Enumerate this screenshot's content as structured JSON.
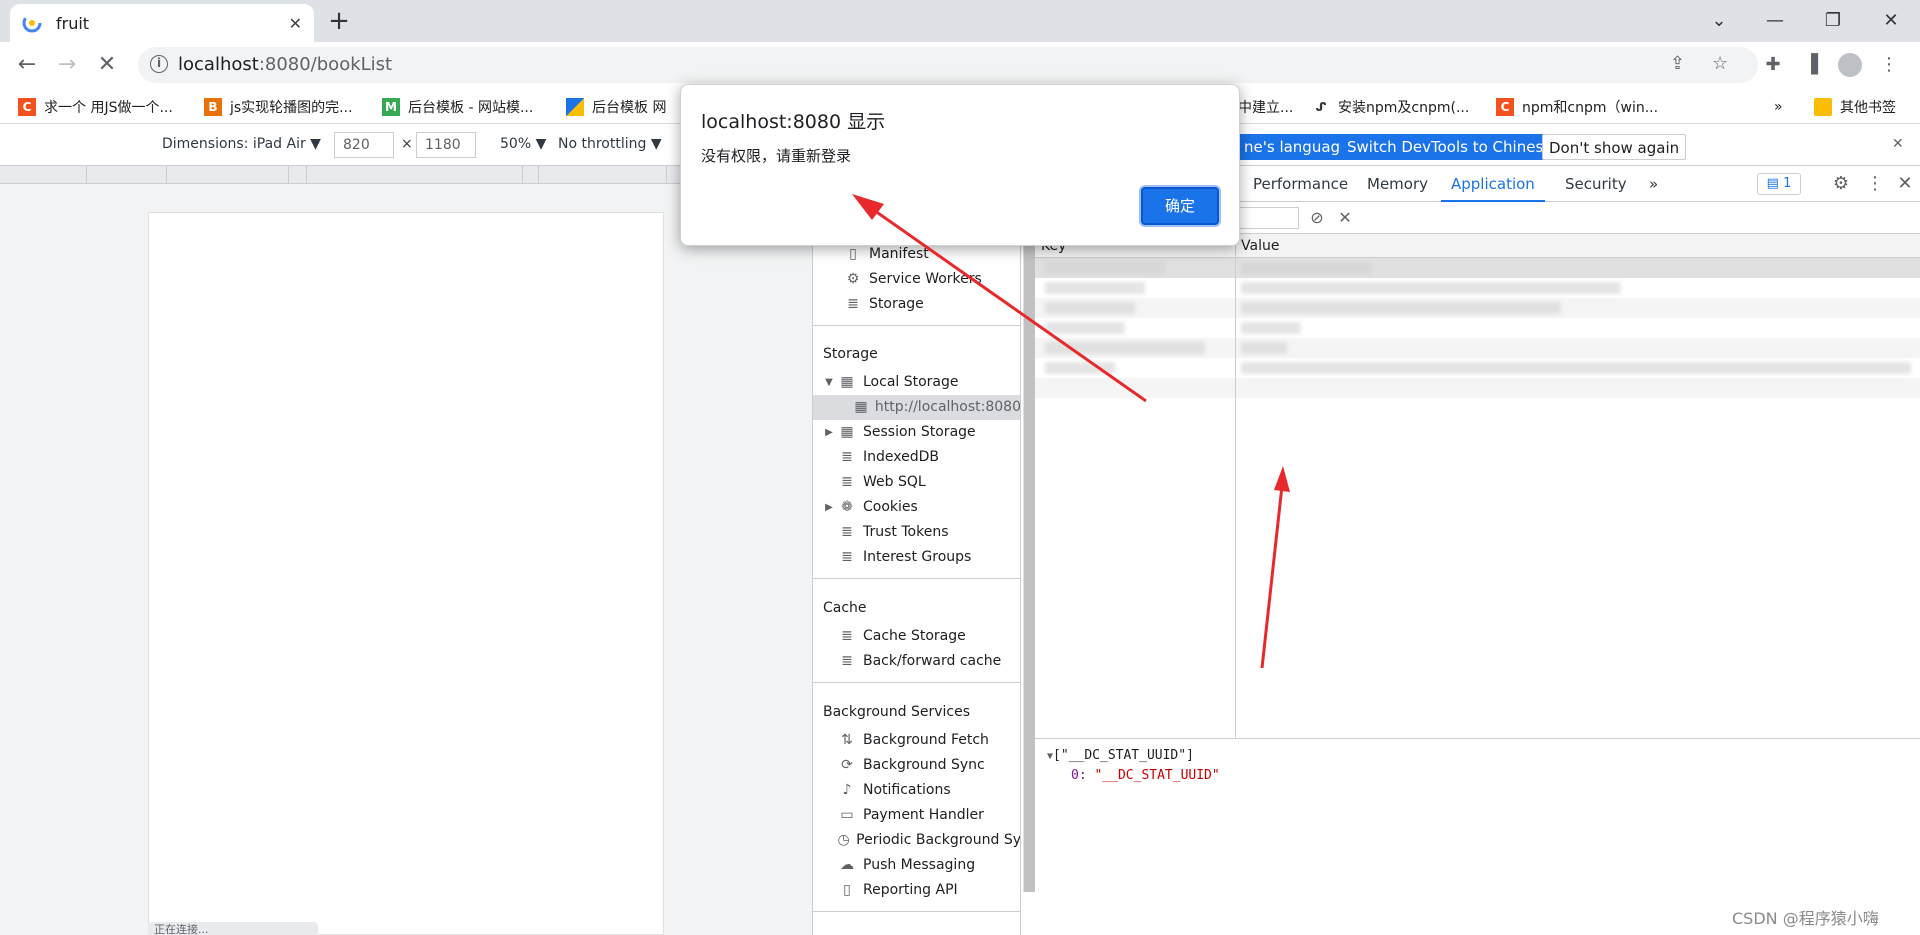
{
  "browser": {
    "tab_title": "fruit",
    "url_host": "localhost",
    "url_rest": ":8080/bookList"
  },
  "bookmarks": [
    {
      "label": "求一个 用JS做一个...",
      "icon": "C",
      "color": "#f4511e"
    },
    {
      "label": "js实现轮播图的完...",
      "icon": "B",
      "color": "#e8710a"
    },
    {
      "label": "后台模板 - 网站模...",
      "icon": "M",
      "color": "#34a853"
    },
    {
      "label": "后台模板 网",
      "icon": "",
      "color": "#1a73e8"
    },
    {
      "label": "中建立...",
      "icon": "",
      "color": "#ffffff"
    },
    {
      "label": "安装npm及cnpm(...",
      "icon": "",
      "color": "#ffffff"
    },
    {
      "label": "npm和cnpm（win...",
      "icon": "C",
      "color": "#f4511e"
    },
    {
      "label": "其他书签",
      "icon": "",
      "color": "#fbbc04"
    }
  ],
  "bookmarks_more": "»",
  "device_toolbar": {
    "dimensions_label": "Dimensions: iPad Air ▼",
    "width": "820",
    "times": "×",
    "height": "1180",
    "zoom": "50% ▼",
    "throttling": "No throttling ▼",
    "lang_btn": "ne's language",
    "switch_btn": "Switch DevTools to Chinese",
    "dont_show_btn": "Don't show again"
  },
  "viewport": {
    "status_text": "正在连接..."
  },
  "devtools": {
    "tabs": [
      "Performance",
      "Memory",
      "Application",
      "Security"
    ],
    "more_tabs": "»",
    "issues_count": "1",
    "sidebar": {
      "app_items": [
        "Manifest",
        "Service Workers",
        "Storage"
      ],
      "storage_title": "Storage",
      "storage_items": [
        "Local Storage",
        "http://localhost:8080",
        "Session Storage",
        "IndexedDB",
        "Web SQL",
        "Cookies",
        "Trust Tokens",
        "Interest Groups"
      ],
      "cache_title": "Cache",
      "cache_items": [
        "Cache Storage",
        "Back/forward cache"
      ],
      "bg_title": "Background Services",
      "bg_items": [
        "Background Fetch",
        "Background Sync",
        "Notifications",
        "Payment Handler",
        "Periodic Background Sy",
        "Push Messaging",
        "Reporting API"
      ]
    },
    "grid": {
      "key_header": "Key",
      "value_header": "Value"
    },
    "preview": {
      "line1": "[\"__DC_STAT_UUID\"]",
      "line2_index": "0: ",
      "line2_value": "\"__DC_STAT_UUID\""
    }
  },
  "alert": {
    "title": "localhost:8080 显示",
    "message": "没有权限，请重新登录",
    "ok_label": "确定"
  },
  "watermark": "CSDN @程序猿小嗨",
  "colors": {
    "accent": "#1a73e8",
    "annotation_arrow": "#e8292b"
  }
}
